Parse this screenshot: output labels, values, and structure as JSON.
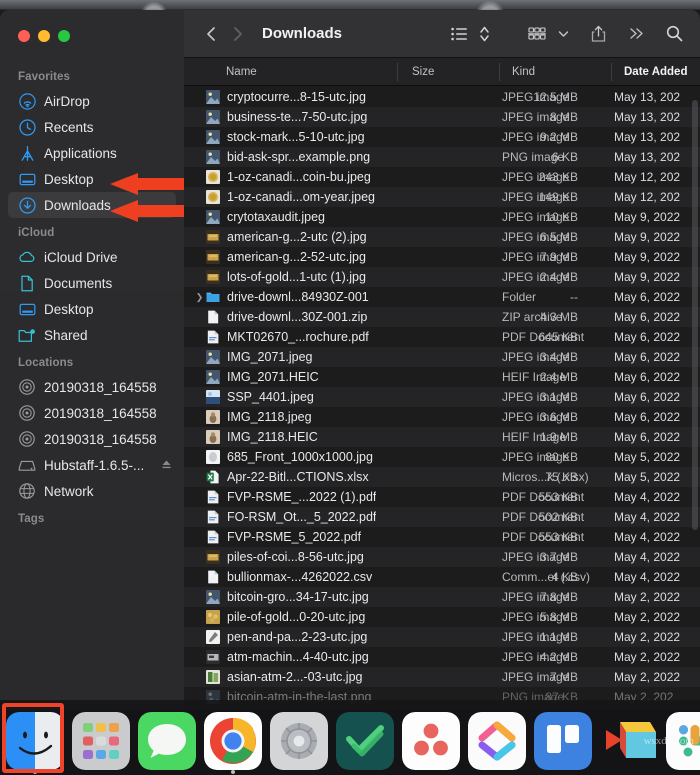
{
  "window": {
    "title": "Downloads",
    "traffic_lights": [
      "close-red",
      "minimize-yellow",
      "maximize-green"
    ]
  },
  "toolbar": {
    "back_label": "‹",
    "forward_label": "›",
    "icons": [
      "list-view-icon",
      "sort-updown-icon",
      "group-by-icon",
      "chevron-down-icon",
      "share-icon",
      "more-chevrons-icon",
      "search-icon"
    ]
  },
  "sidebar": {
    "groups": [
      {
        "title": "Favorites",
        "items": [
          {
            "label": "AirDrop",
            "icon": "airdrop-icon",
            "selected": false
          },
          {
            "label": "Recents",
            "icon": "clock-icon",
            "selected": false
          },
          {
            "label": "Applications",
            "icon": "applications-icon",
            "selected": false
          },
          {
            "label": "Desktop",
            "icon": "desktop-icon",
            "selected": false
          },
          {
            "label": "Downloads",
            "icon": "downloads-icon",
            "selected": true
          }
        ]
      },
      {
        "title": "iCloud",
        "items": [
          {
            "label": "iCloud Drive",
            "icon": "cloud-icon",
            "selected": false
          },
          {
            "label": "Documents",
            "icon": "document-icon",
            "selected": false
          },
          {
            "label": "Desktop",
            "icon": "desktop-icon",
            "selected": false
          },
          {
            "label": "Shared",
            "icon": "shared-folder-icon",
            "selected": false
          }
        ]
      },
      {
        "title": "Locations",
        "items": [
          {
            "label": "20190318_164558",
            "icon": "disk-icon",
            "selected": false
          },
          {
            "label": "20190318_164558",
            "icon": "disk-icon",
            "selected": false
          },
          {
            "label": "20190318_164558",
            "icon": "disk-icon",
            "selected": false
          },
          {
            "label": "Hubstaff-1.6.5-...",
            "icon": "external-drive-icon",
            "selected": false,
            "eject": true
          },
          {
            "label": "Network",
            "icon": "network-globe-icon",
            "selected": false
          }
        ]
      },
      {
        "title": "Tags",
        "items": []
      }
    ]
  },
  "annotations": {
    "arrows": [
      {
        "name": "arrow-pointing-desktop",
        "target": "Desktop"
      },
      {
        "name": "arrow-pointing-downloads",
        "target": "Downloads"
      }
    ],
    "highlight_box": {
      "name": "finder-dock-highlight",
      "color": "#f0442a",
      "target": "Finder"
    }
  },
  "file_list": {
    "columns": [
      "Name",
      "Size",
      "Kind",
      "Date Added"
    ],
    "sort_column": "Date Added",
    "rows": [
      {
        "name": "cryptocurre...8-15-utc.jpg",
        "size": "12.5 MB",
        "kind": "JPEG image",
        "date": "May 13, 202",
        "icon": "photo-thumb",
        "folder": false
      },
      {
        "name": "business-te...7-50-utc.jpg",
        "size": "8 MB",
        "kind": "JPEG image",
        "date": "May 13, 202",
        "icon": "photo-thumb",
        "folder": false
      },
      {
        "name": "stock-mark...5-10-utc.jpg",
        "size": "9.2 MB",
        "kind": "JPEG image",
        "date": "May 13, 202",
        "icon": "photo-thumb",
        "folder": false
      },
      {
        "name": "bid-ask-spr...example.png",
        "size": "6 KB",
        "kind": "PNG image",
        "date": "May 13, 202",
        "icon": "photo-thumb",
        "folder": false
      },
      {
        "name": "1-oz-canadi...coin-bu.jpeg",
        "size": "243 KB",
        "kind": "JPEG image",
        "date": "May 12, 202",
        "icon": "coin-thumb",
        "folder": false
      },
      {
        "name": "1-oz-canadi...om-year.jpeg",
        "size": "149 KB",
        "kind": "JPEG image",
        "date": "May 12, 202",
        "icon": "coin-thumb",
        "folder": false
      },
      {
        "name": "crytotaxaudit.jpeg",
        "size": "10 KB",
        "kind": "JPEG image",
        "date": "May 9, 2022",
        "icon": "photo-thumb",
        "folder": false
      },
      {
        "name": "american-g...2-utc (2).jpg",
        "size": "6.5 MB",
        "kind": "JPEG image",
        "date": "May 9, 2022",
        "icon": "gold-thumb",
        "folder": false
      },
      {
        "name": "american-g...2-52-utc.jpg",
        "size": "7.9 MB",
        "kind": "JPEG image",
        "date": "May 9, 2022",
        "icon": "gold-thumb",
        "folder": false
      },
      {
        "name": "lots-of-gold...1-utc (1).jpg",
        "size": "2.4 MB",
        "kind": "JPEG image",
        "date": "May 9, 2022",
        "icon": "gold-thumb",
        "folder": false
      },
      {
        "name": "drive-downl...84930Z-001",
        "size": "--",
        "kind": "Folder",
        "date": "May 6, 2022",
        "icon": "folder",
        "folder": true
      },
      {
        "name": "drive-downl...30Z-001.zip",
        "size": "4.3 MB",
        "kind": "ZIP archive",
        "date": "May 6, 2022",
        "icon": "doc-blank",
        "folder": false
      },
      {
        "name": "MKT02670_...rochure.pdf",
        "size": "645 KB",
        "kind": "PDF Document",
        "date": "May 6, 2022",
        "icon": "pdf",
        "folder": false
      },
      {
        "name": "IMG_2071.jpeg",
        "size": "3.4 MB",
        "kind": "JPEG image",
        "date": "May 6, 2022",
        "icon": "photo-thumb",
        "folder": false
      },
      {
        "name": "IMG_2071.HEIC",
        "size": "2.4 MB",
        "kind": "HEIF Image",
        "date": "May 6, 2022",
        "icon": "photo-thumb",
        "folder": false
      },
      {
        "name": "SSP_4401.jpeg",
        "size": "3.1 MB",
        "kind": "JPEG image",
        "date": "May 6, 2022",
        "icon": "blue-thumb",
        "folder": false
      },
      {
        "name": "IMG_2118.jpeg",
        "size": "3.6 MB",
        "kind": "JPEG image",
        "date": "May 6, 2022",
        "icon": "tan-thumb",
        "folder": false
      },
      {
        "name": "IMG_2118.HEIC",
        "size": "1.9 MB",
        "kind": "HEIF Image",
        "date": "May 6, 2022",
        "icon": "tan-thumb",
        "folder": false
      },
      {
        "name": "685_Front_1000x1000.jpg",
        "size": "80 KB",
        "kind": "JPEG image",
        "date": "May 5, 2022",
        "icon": "silver-thumb",
        "folder": false
      },
      {
        "name": "Apr-22-Bitl...CTIONS.xlsx",
        "size": "75 KB",
        "kind": "Micros...k (.xlsx)",
        "date": "May 5, 2022",
        "icon": "xlsx",
        "folder": false
      },
      {
        "name": "FVP-RSME_...2022 (1).pdf",
        "size": "553 KB",
        "kind": "PDF Document",
        "date": "May 4, 2022",
        "icon": "pdf",
        "folder": false
      },
      {
        "name": "FO-RSM_Ot..._5_2022.pdf",
        "size": "502 KB",
        "kind": "PDF Document",
        "date": "May 4, 2022",
        "icon": "pdf",
        "folder": false
      },
      {
        "name": "FVP-RSME_5_2022.pdf",
        "size": "553 KB",
        "kind": "PDF Document",
        "date": "May 4, 2022",
        "icon": "pdf",
        "folder": false
      },
      {
        "name": "piles-of-coi...8-56-utc.jpg",
        "size": "3.7 MB",
        "kind": "JPEG image",
        "date": "May 4, 2022",
        "icon": "gold-thumb",
        "folder": false
      },
      {
        "name": "bullionmax-...4262022.csv",
        "size": "4 KB",
        "kind": "Comm...et (.csv)",
        "date": "May 4, 2022",
        "icon": "doc-blank",
        "folder": false
      },
      {
        "name": "bitcoin-gro...34-17-utc.jpg",
        "size": "7.8 MB",
        "kind": "JPEG image",
        "date": "May 2, 2022",
        "icon": "photo-thumb",
        "folder": false
      },
      {
        "name": "pile-of-gold...0-20-utc.jpg",
        "size": "5.8 MB",
        "kind": "JPEG image",
        "date": "May 2, 2022",
        "icon": "goldpile-thumb",
        "folder": false
      },
      {
        "name": "pen-and-pa...2-23-utc.jpg",
        "size": "1.1 MB",
        "kind": "JPEG image",
        "date": "May 2, 2022",
        "icon": "white-thumb",
        "folder": false
      },
      {
        "name": "atm-machin...4-40-utc.jpg",
        "size": "4.2 MB",
        "kind": "JPEG image",
        "date": "May 2, 2022",
        "icon": "grey-thumb",
        "folder": false
      },
      {
        "name": "asian-atm-2...-03-utc.jpg",
        "size": "7 MB",
        "kind": "JPEG image",
        "date": "May 2, 2022",
        "icon": "green-thumb",
        "folder": false
      },
      {
        "name": "bitcoin-atm-in-the-last.png",
        "size": "87 KB",
        "kind": "PNG image",
        "date": "May 2, 202",
        "icon": "photo-thumb",
        "folder": false
      }
    ]
  },
  "dock": {
    "items": [
      {
        "label": "Finder",
        "icon": "finder-icon",
        "running": true
      },
      {
        "label": "Launchpad",
        "icon": "launchpad-icon",
        "running": false
      },
      {
        "label": "Messages",
        "icon": "messages-icon",
        "running": false
      },
      {
        "label": "Google Chrome",
        "icon": "chrome-icon",
        "running": true
      },
      {
        "label": "System Preferences",
        "icon": "settings-icon",
        "running": false
      },
      {
        "label": "Wrike",
        "icon": "wrike-icon",
        "running": false
      },
      {
        "label": "Asana",
        "icon": "asana-icon",
        "running": false
      },
      {
        "label": "ClickUp",
        "icon": "clickup-icon",
        "running": false
      },
      {
        "label": "Trello",
        "icon": "trello-icon",
        "running": false
      },
      {
        "label": "Prezi",
        "icon": "prezi-icon",
        "running": false
      },
      {
        "label": "Slack",
        "icon": "slack-icon",
        "running": false
      }
    ]
  },
  "watermark": {
    "text": "wsxdn.com"
  }
}
